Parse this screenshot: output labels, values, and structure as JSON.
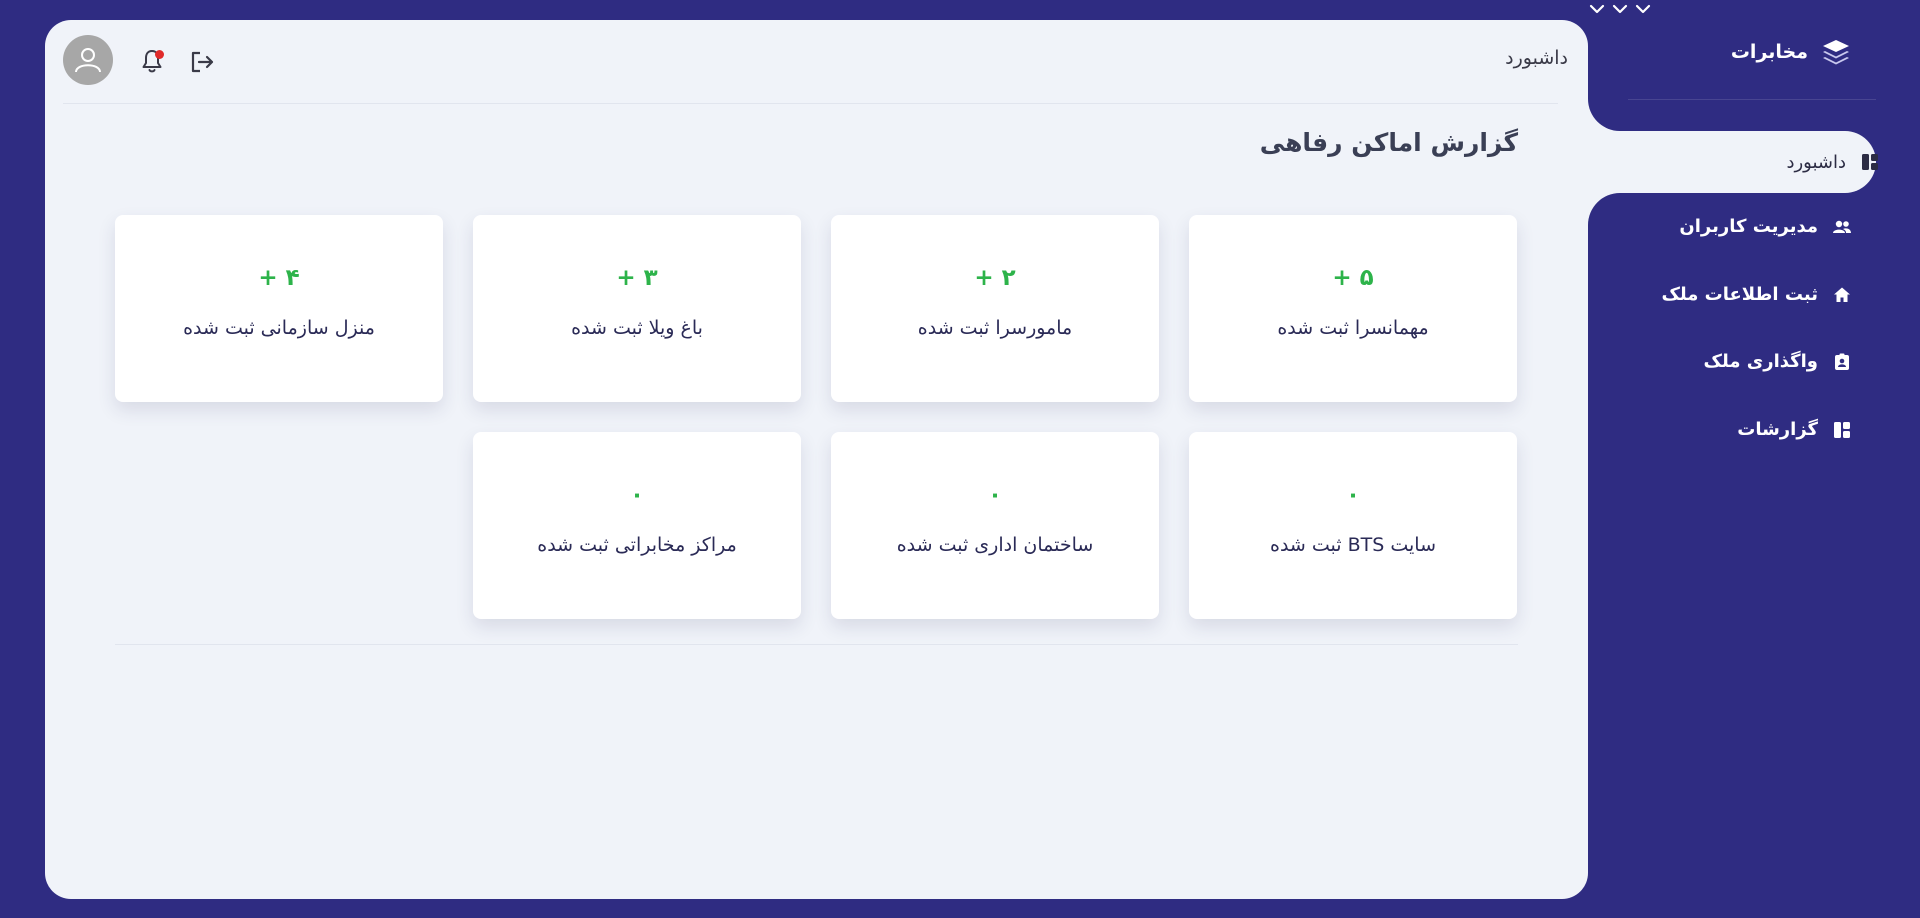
{
  "sidebar": {
    "brand": "مخابرات",
    "items": [
      {
        "label": "داشبورد",
        "active": true,
        "icon": "dashboard-icon"
      },
      {
        "label": "مدیریت کاربران",
        "icon": "users-icon",
        "has_submenu": true
      },
      {
        "label": "ثبت اطلاعات ملک",
        "icon": "home-icon",
        "has_submenu": true
      },
      {
        "label": "واگذاری ملک",
        "icon": "badge-icon",
        "has_submenu": true
      },
      {
        "label": "گزارشات",
        "icon": "report-icon"
      }
    ]
  },
  "header": {
    "breadcrumb": "داشبورد",
    "notification_dot_color": "#e02a2a"
  },
  "main": {
    "title": "گزارش اماکن رفاهی",
    "cards": [
      {
        "value": "+ ۵",
        "label": "مهمانسرا ثبت شده"
      },
      {
        "value": "+ ۲",
        "label": "مامورسرا ثبت شده"
      },
      {
        "value": "+ ۳",
        "label": "باغ ویلا ثبت شده"
      },
      {
        "value": "+ ۴",
        "label": "منزل سازمانی ثبت شده"
      },
      {
        "value": "۰",
        "label": "سایت BTS ثبت شده"
      },
      {
        "value": "۰",
        "label": "ساختمان اداری ثبت شده"
      },
      {
        "value": "۰",
        "label": "مراکز مخابراتی ثبت شده"
      }
    ]
  },
  "colors": {
    "sidebar_bg": "#2f2c82",
    "panel_bg": "#f0f3f9",
    "value_green": "#2db34a",
    "label_navy": "#2a2a56"
  }
}
